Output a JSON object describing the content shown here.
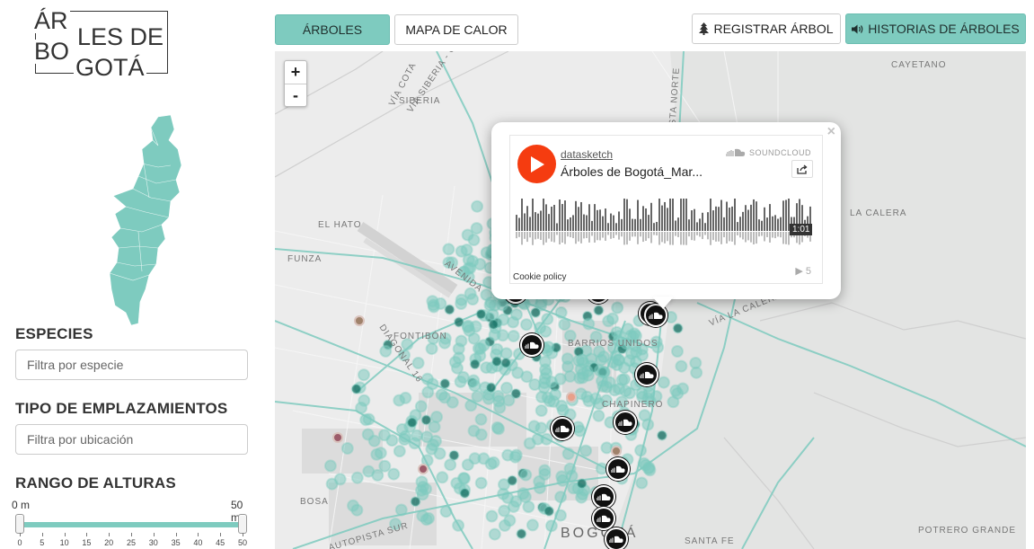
{
  "logo": {
    "line1": "ÁR",
    "line2": "LES DE",
    "line3": "BO",
    "line4": "GOTÁ"
  },
  "sidebar": {
    "species_title": "ESPECIES",
    "species_placeholder": "Filtra por especie",
    "location_title": "TIPO DE EMPLAZAMIENTOS",
    "location_placeholder": "Filtra por ubicación",
    "height_title": "RANGO DE ALTURAS",
    "height_min_label": "0 m",
    "height_max_label": "50 m",
    "height_range": [
      0,
      50
    ],
    "height_ticks": [
      "0",
      "5",
      "10",
      "15",
      "20",
      "25",
      "30",
      "35",
      "40",
      "45",
      "50"
    ]
  },
  "tabs": {
    "trees": "ÁRBOLES",
    "heatmap": "MAPA DE CALOR"
  },
  "actions": {
    "register": "REGISTRAR ÁRBOL",
    "stories": "HISTORIAS DE ÁRBOLES"
  },
  "map": {
    "zoom_in": "+",
    "zoom_out": "-",
    "places": {
      "via_cota": "VÍA COTA",
      "via_siberia": "VÍA SIBERIA - COTA",
      "siberia": "SIBERIA",
      "autopista_norte": "AUTOPISTA NORTE",
      "cayetano": "CAYETANO",
      "el_hato": "EL HATO",
      "funza": "FUNZA",
      "la_calera": "LA CALERA",
      "via_la_calera": "VÍA LA CALERA",
      "avenida": "AVENIDA",
      "fontibon": "FONTIBÓN",
      "diagonal_16": "DIAGONAL 16",
      "barrios_unidos": "BARRIOS UNIDOS",
      "chapinero": "CHAPINERO",
      "bosa": "BOSA",
      "autopista_sur": "AUTOPISTA SUR",
      "bogota": "BOGOTÁ",
      "santa_fe": "SANTA FE",
      "potrero_grande": "POTRERO GRANDE"
    }
  },
  "popup": {
    "close": "×",
    "user": "datasketch",
    "track": "Árboles de Bogotá_Mar...",
    "brand": "SOUNDCLOUD",
    "duration": "1:01",
    "cookie": "Cookie policy",
    "plays": "▶ 5"
  },
  "colors": {
    "accent": "#7ecbbf",
    "accent_dark": "#0e6b5e",
    "soundcloud": "#f53c10"
  },
  "icons": {
    "tree": "tree-icon",
    "speaker": "volume-icon",
    "play": "play-icon",
    "share": "share-icon",
    "soundcloud": "soundcloud-icon"
  }
}
